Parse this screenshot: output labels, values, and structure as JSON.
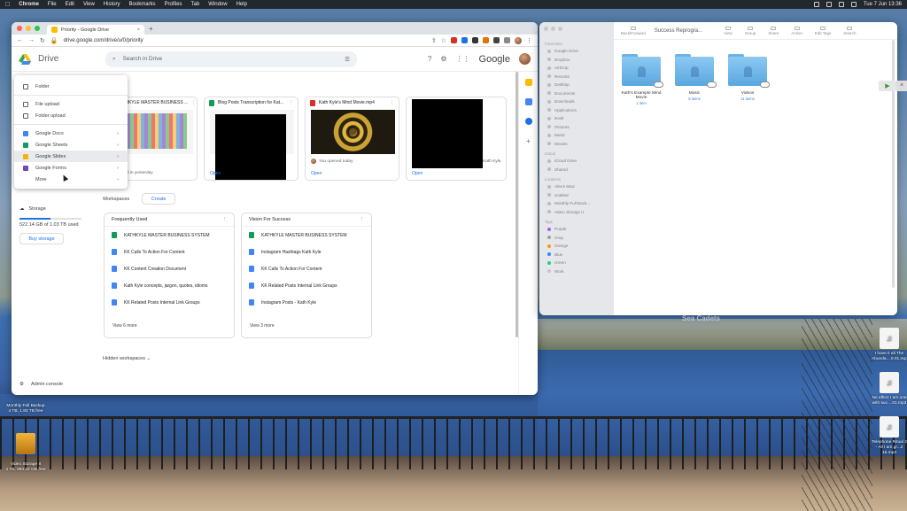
{
  "menubar": {
    "app": "Chrome",
    "items": [
      "File",
      "Edit",
      "View",
      "History",
      "Bookmarks",
      "Profiles",
      "Tab",
      "Window",
      "Help"
    ],
    "clock": "Tue 7 Jun 13:36"
  },
  "browser": {
    "tab_title": "Priority - Google Drive",
    "url": "drive.google.com/drive/u/0/priority"
  },
  "drive": {
    "title": "Drive",
    "search_placeholder": "Search in Drive",
    "brand": "Google",
    "new_menu": {
      "folder": "Folder",
      "file_upload": "File upload",
      "folder_upload": "Folder upload",
      "docs": "Google Docs",
      "sheets": "Google Sheets",
      "slides": "Google Slides",
      "forms": "Google Forms",
      "more": "More"
    },
    "storage": {
      "label": "Storage",
      "used_text": "522.14 GB of 1.03 TB used",
      "used_fraction": 0.5,
      "buy": "Buy storage"
    },
    "admin": "Admin console",
    "cards": [
      {
        "title": "KATHKYLE MASTER BUSINESS ...",
        "foot": "You edited in yesterday"
      },
      {
        "title": "Blog Posts Transcription for Kat...",
        "foot": "Open"
      },
      {
        "title": "Kath Kyle's Mind Movie.mp4",
        "foot": "You opened today",
        "open": "Open"
      },
      {
        "title": "",
        "foot": "Kath Kyle",
        "open": "Open"
      }
    ],
    "workspaces_label": "Workspaces",
    "create": "Create",
    "workspaces": [
      {
        "title": "Frequently Used",
        "items": [
          "KATHKYLE MASTER BUSINESS SYSTEM",
          "KK Calls To Action For Content",
          "KK Content Creation Document",
          "Kath Kyle concepts, jargon, quotes, idioms",
          "KK Related Posts Internal Link Groups"
        ],
        "more": "View 6 more"
      },
      {
        "title": "Vision For Success",
        "items": [
          "KATHKYLE MASTER BUSINESS SYSTEM",
          "Instagram Hashtags Kath Kyle",
          "KK Calls To Action For Content",
          "KK Related Posts Internal Link Groups",
          "Instagram Posts - Kath Kyle"
        ],
        "more": "View 3 more"
      }
    ],
    "hidden_workspaces": "Hidden workspaces"
  },
  "finder": {
    "title": "Success Reprogra...",
    "toolbar": [
      "Back/Forward",
      "View",
      "Group",
      "Share",
      "Action",
      "Edit Tags",
      "Search"
    ],
    "sidebar": {
      "favourites_label": "Favourites",
      "favourites": [
        "Google Drive",
        "Dropbox",
        "AirDrop",
        "Recents",
        "Desktop",
        "Documents",
        "Downloads",
        "Applications",
        "iKath",
        "Pictures",
        "Music",
        "Movies"
      ],
      "icloud_label": "iCloud",
      "icloud": [
        "iCloud Drive",
        "Shared"
      ],
      "locations_label": "Locations",
      "locations": [
        "Alex's iMac",
        "Untitled",
        "Monthly Full Back...",
        "Video Storage II"
      ],
      "tags_label": "Tags",
      "tags": [
        "Purple",
        "Gray",
        "Orange",
        "Blue",
        "Green",
        "Work"
      ]
    },
    "folders": [
      {
        "name": "Kath's Example Mind Movie",
        "sub": "1 item"
      },
      {
        "name": "Music",
        "sub": "8 items"
      },
      {
        "name": "Videos",
        "sub": "11 items"
      }
    ]
  },
  "desktop": {
    "drive1": "Monthly Full Backup\n4 TB, 1.83 TB free",
    "drive2": "Video Storage II\n4 TB, 993.82 GB free",
    "file1": "I have it all The Abunda....0.01.mp3",
    "file2": "No affect I am one with suc....01.mp3",
    "file3": "Telephone Ritual 2 - All I am gr...2 16.mp3",
    "sign": "Sea Cadets"
  },
  "colors": {
    "drive_blue": "#1a73e8",
    "folder_blue": "#6ab7ec"
  }
}
